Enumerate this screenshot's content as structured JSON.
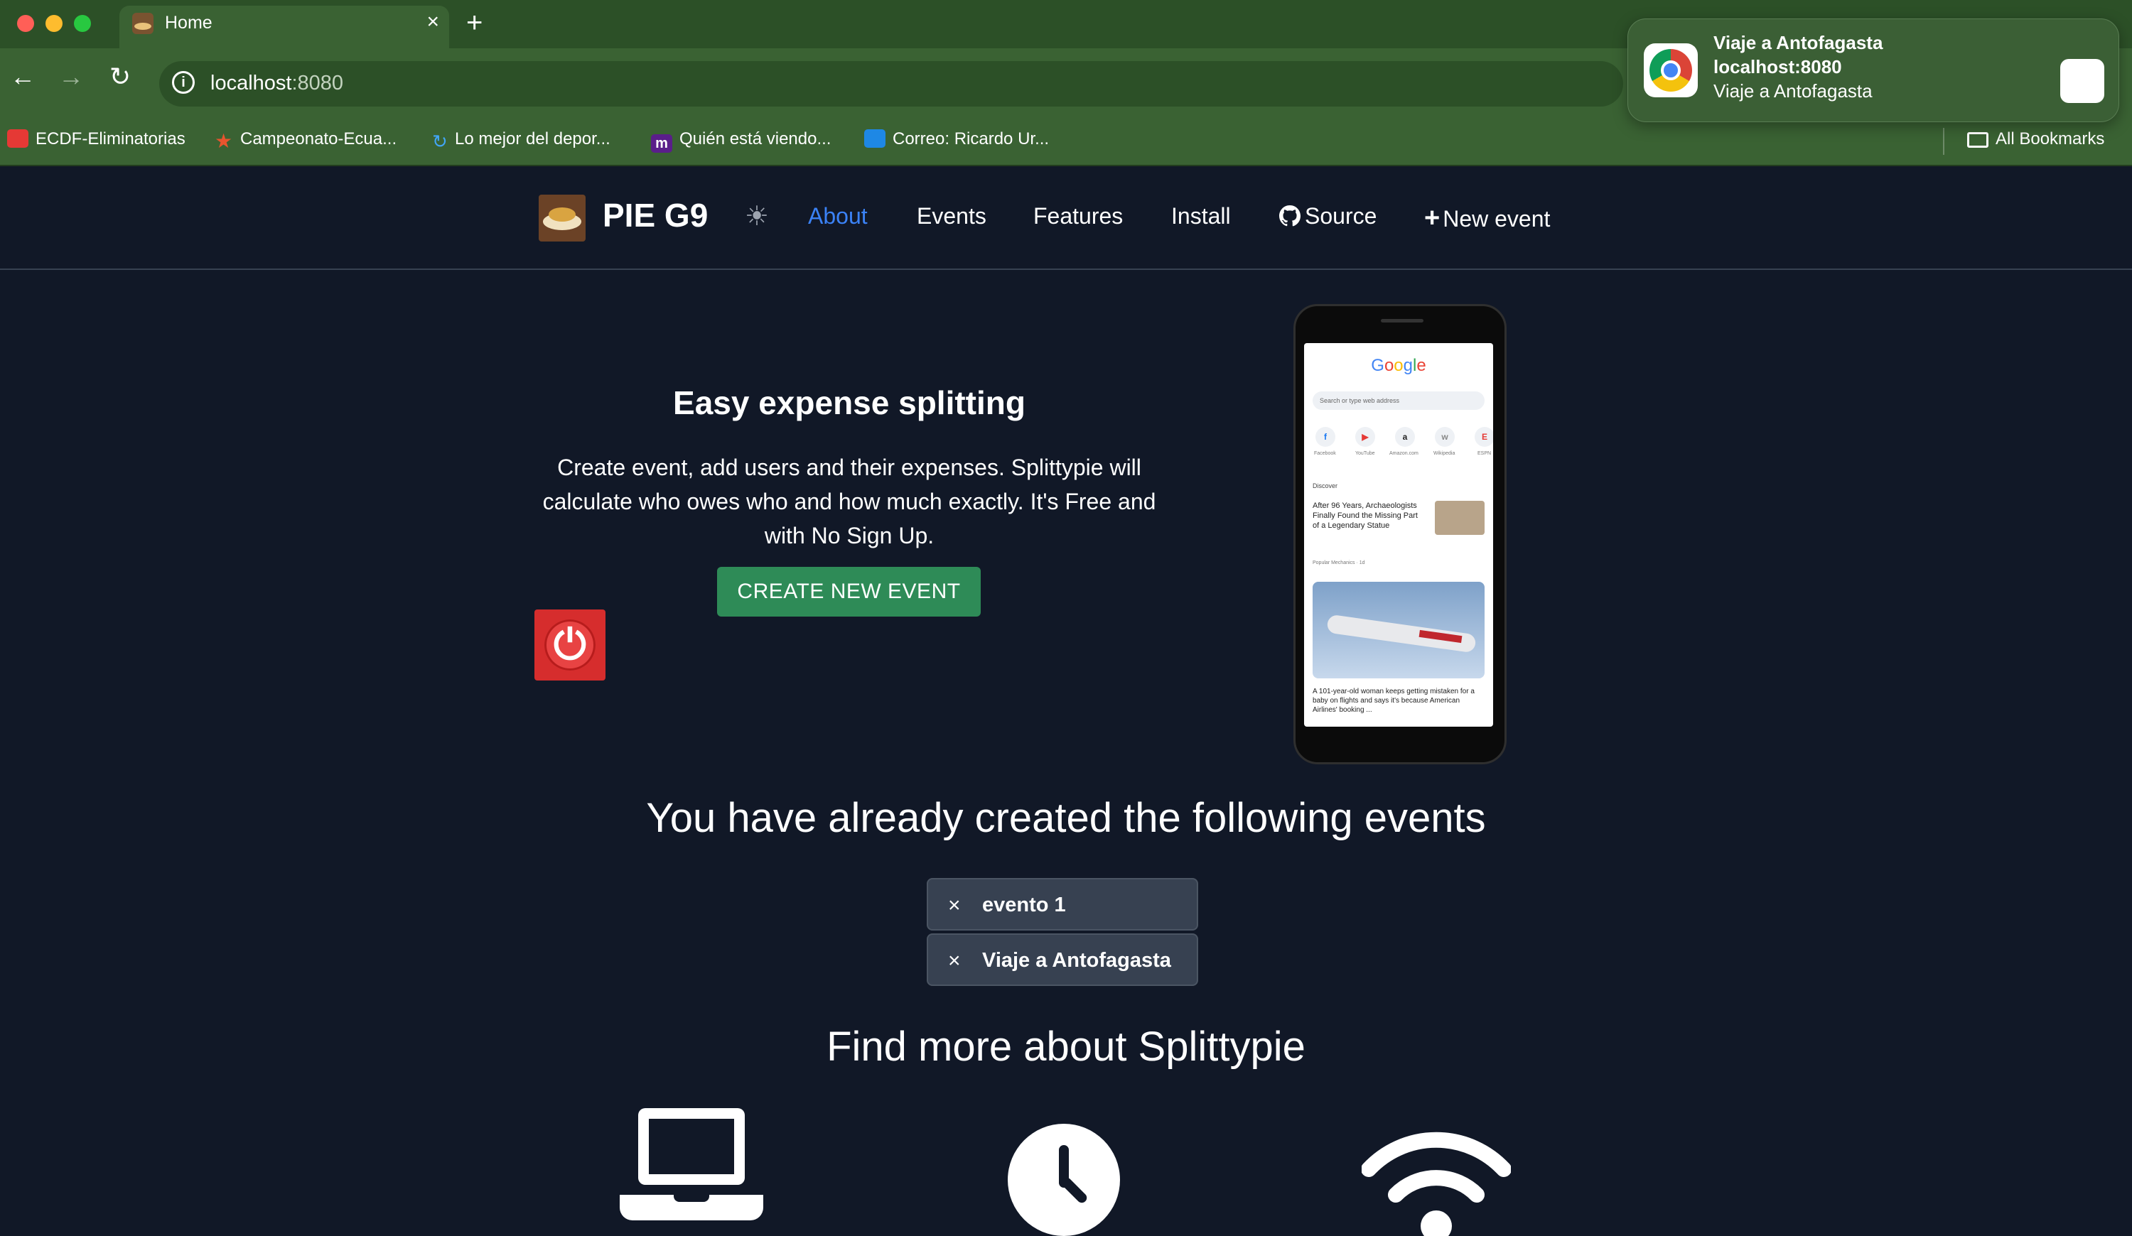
{
  "browser": {
    "tab_title": "Home",
    "tab_close": "×",
    "new_tab": "+",
    "url_host": "localhost",
    "url_port": ":8080",
    "nav": {
      "back": "←",
      "forward": "→",
      "reload": "↻"
    },
    "bookmarks": [
      {
        "label": "ECDF-Eliminatorias",
        "color": "#e53935"
      },
      {
        "label": "Campeonato-Ecua...",
        "color": "#e8542e"
      },
      {
        "label": "Lo mejor del depor...",
        "color": "#42a5f5"
      },
      {
        "label": "Quién está viendo...",
        "color": "#5a1e8a"
      },
      {
        "label": "Correo: Ricardo Ur...",
        "color": "#1e88e5"
      }
    ],
    "all_bookmarks": "All Bookmarks"
  },
  "notification": {
    "title": "Viaje a Antofagasta",
    "source": "localhost:8080",
    "body": "Viaje a Antofagasta"
  },
  "nav": {
    "brand": "PIE G9",
    "theme_icon": "☀",
    "links": [
      "About",
      "Events",
      "Features",
      "Install",
      "Source",
      "New event"
    ],
    "active": "About",
    "source_icon": "github-icon",
    "new_event_icon": "+"
  },
  "hero": {
    "title": "Easy expense splitting",
    "description": "Create event, add users and their expenses. Splittypie will calculate who owes who and how much exactly. It's Free and with No Sign Up.",
    "cta": "CREATE NEW EVENT"
  },
  "phone": {
    "search_placeholder": "Search or type web address",
    "shortcuts": [
      "Facebook",
      "YouTube",
      "Amazon.com",
      "Wikipedia",
      "ESPN"
    ],
    "discover": "Discover",
    "article_title": "After 96 Years, Archaeologists Finally Found the Missing Part of a Legendary Statue",
    "article_source": "Popular Mechanics · 1d",
    "caption": "A 101-year-old woman keeps getting mistaken for a baby on flights and says it's because American Airlines' booking ..."
  },
  "events": {
    "title": "You have already created the following events",
    "items": [
      "evento 1",
      "Viaje a Antofagasta"
    ],
    "remove_icon": "×"
  },
  "features": {
    "title": "Find more about Splittypie",
    "icons": [
      "laptop-icon",
      "clock-icon",
      "wifi-icon"
    ]
  }
}
